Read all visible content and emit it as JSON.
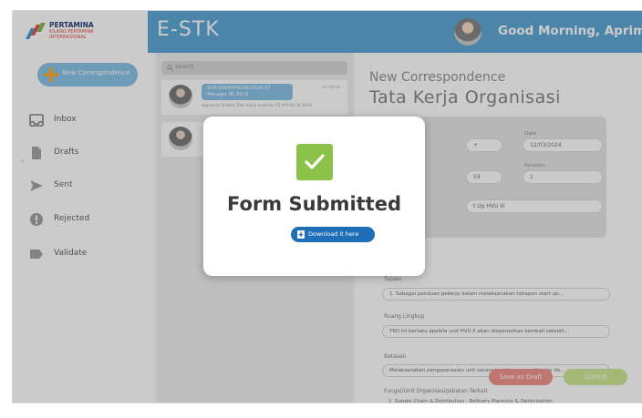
{
  "header": {
    "logo_line1": "PERTAMINA",
    "logo_line2": "KILANG PERTAMINA",
    "logo_line3": "INTERNASIONAL",
    "app_name": "E-STK",
    "greeting": "Good Morning, Aprimal"
  },
  "sidebar": {
    "new_button": "New Correspondence",
    "items": [
      {
        "label": "Inbox",
        "icon": "inbox-icon"
      },
      {
        "label": "Drafts",
        "icon": "file-icon"
      },
      {
        "label": "Sent",
        "icon": "send-icon"
      },
      {
        "label": "Rejected",
        "icon": "alert-icon"
      },
      {
        "label": "Validate",
        "icon": "tag-icon"
      }
    ]
  },
  "list": {
    "search_placeholder": "Search",
    "items": [
      {
        "tag_line1": "SOA-004/KPI40100/2024-S7",
        "tag_line2": "Manager HC RU III",
        "time": "14:00:24",
        "snippet": "Approval Sistem Tata Kerja Individu PT KPI RU III 2024"
      }
    ]
  },
  "main": {
    "title_small": "New Correspondence",
    "title_large": "Tata Kerja Organisasi",
    "date_label": "Date",
    "date_value": "12/03/2024",
    "revision_label": "Revision",
    "revision_value": "1",
    "partial_field1": "+",
    "partial_field2": "59",
    "subject_partial": "t Up HVU III",
    "tujuan_label": "Tujuan",
    "tujuan_value": "1. Sebagai panduan pekerja dalam melaksanakan tahapan start up...",
    "ruang_label": "Ruang Lingkup",
    "ruang_value": "TKO ini berlaku apabila unit HVU II akan dioperasikan kembali setelah...",
    "batasan_label": "Batasan",
    "batasan_value": "Melaksanakan pengoperasian unit secara bertahap yang dimulai da...",
    "fungsi_label": "Fungsi/Unit Organisasi/Jabatan Terkait",
    "fungsi_value": "1. Supply Chain & Distribution - Refinery Planning & Optimization",
    "save_draft": "Save as Draft",
    "submit": "Submit"
  },
  "modal": {
    "title": "Form Submitted",
    "download_button": "Download it here"
  },
  "colors": {
    "header_blue": "#4e9fd1",
    "accent_light_blue": "#7fbde4",
    "success_green": "#8bc34a",
    "download_blue": "#1e6fb8",
    "draft_red": "#ef8a83",
    "submit_green": "#c9e58b"
  }
}
